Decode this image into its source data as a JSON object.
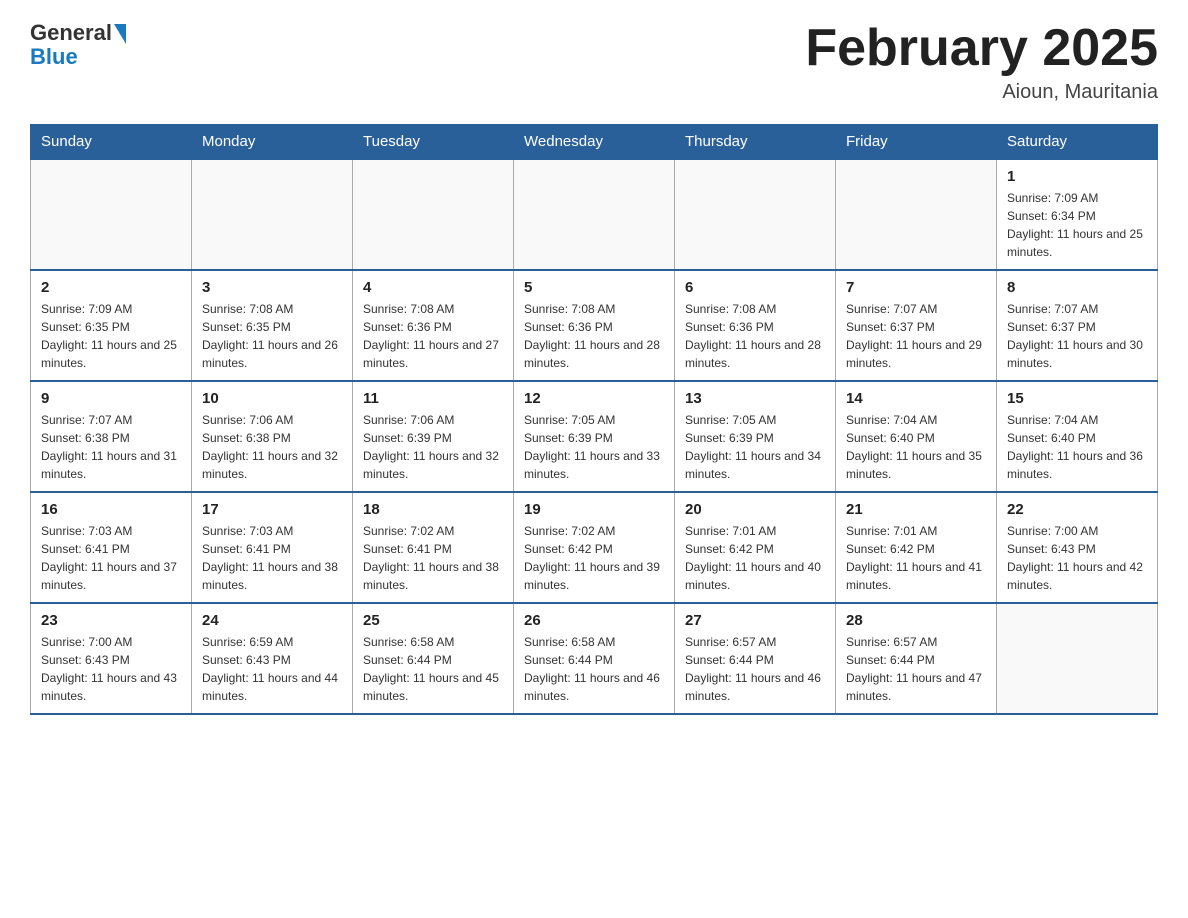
{
  "header": {
    "logo_general": "General",
    "logo_blue": "Blue",
    "month_title": "February 2025",
    "location": "Aioun, Mauritania"
  },
  "days_of_week": [
    "Sunday",
    "Monday",
    "Tuesday",
    "Wednesday",
    "Thursday",
    "Friday",
    "Saturday"
  ],
  "weeks": [
    {
      "days": [
        {
          "number": "",
          "info": ""
        },
        {
          "number": "",
          "info": ""
        },
        {
          "number": "",
          "info": ""
        },
        {
          "number": "",
          "info": ""
        },
        {
          "number": "",
          "info": ""
        },
        {
          "number": "",
          "info": ""
        },
        {
          "number": "1",
          "info": "Sunrise: 7:09 AM\nSunset: 6:34 PM\nDaylight: 11 hours and 25 minutes."
        }
      ]
    },
    {
      "days": [
        {
          "number": "2",
          "info": "Sunrise: 7:09 AM\nSunset: 6:35 PM\nDaylight: 11 hours and 25 minutes."
        },
        {
          "number": "3",
          "info": "Sunrise: 7:08 AM\nSunset: 6:35 PM\nDaylight: 11 hours and 26 minutes."
        },
        {
          "number": "4",
          "info": "Sunrise: 7:08 AM\nSunset: 6:36 PM\nDaylight: 11 hours and 27 minutes."
        },
        {
          "number": "5",
          "info": "Sunrise: 7:08 AM\nSunset: 6:36 PM\nDaylight: 11 hours and 28 minutes."
        },
        {
          "number": "6",
          "info": "Sunrise: 7:08 AM\nSunset: 6:36 PM\nDaylight: 11 hours and 28 minutes."
        },
        {
          "number": "7",
          "info": "Sunrise: 7:07 AM\nSunset: 6:37 PM\nDaylight: 11 hours and 29 minutes."
        },
        {
          "number": "8",
          "info": "Sunrise: 7:07 AM\nSunset: 6:37 PM\nDaylight: 11 hours and 30 minutes."
        }
      ]
    },
    {
      "days": [
        {
          "number": "9",
          "info": "Sunrise: 7:07 AM\nSunset: 6:38 PM\nDaylight: 11 hours and 31 minutes."
        },
        {
          "number": "10",
          "info": "Sunrise: 7:06 AM\nSunset: 6:38 PM\nDaylight: 11 hours and 32 minutes."
        },
        {
          "number": "11",
          "info": "Sunrise: 7:06 AM\nSunset: 6:39 PM\nDaylight: 11 hours and 32 minutes."
        },
        {
          "number": "12",
          "info": "Sunrise: 7:05 AM\nSunset: 6:39 PM\nDaylight: 11 hours and 33 minutes."
        },
        {
          "number": "13",
          "info": "Sunrise: 7:05 AM\nSunset: 6:39 PM\nDaylight: 11 hours and 34 minutes."
        },
        {
          "number": "14",
          "info": "Sunrise: 7:04 AM\nSunset: 6:40 PM\nDaylight: 11 hours and 35 minutes."
        },
        {
          "number": "15",
          "info": "Sunrise: 7:04 AM\nSunset: 6:40 PM\nDaylight: 11 hours and 36 minutes."
        }
      ]
    },
    {
      "days": [
        {
          "number": "16",
          "info": "Sunrise: 7:03 AM\nSunset: 6:41 PM\nDaylight: 11 hours and 37 minutes."
        },
        {
          "number": "17",
          "info": "Sunrise: 7:03 AM\nSunset: 6:41 PM\nDaylight: 11 hours and 38 minutes."
        },
        {
          "number": "18",
          "info": "Sunrise: 7:02 AM\nSunset: 6:41 PM\nDaylight: 11 hours and 38 minutes."
        },
        {
          "number": "19",
          "info": "Sunrise: 7:02 AM\nSunset: 6:42 PM\nDaylight: 11 hours and 39 minutes."
        },
        {
          "number": "20",
          "info": "Sunrise: 7:01 AM\nSunset: 6:42 PM\nDaylight: 11 hours and 40 minutes."
        },
        {
          "number": "21",
          "info": "Sunrise: 7:01 AM\nSunset: 6:42 PM\nDaylight: 11 hours and 41 minutes."
        },
        {
          "number": "22",
          "info": "Sunrise: 7:00 AM\nSunset: 6:43 PM\nDaylight: 11 hours and 42 minutes."
        }
      ]
    },
    {
      "days": [
        {
          "number": "23",
          "info": "Sunrise: 7:00 AM\nSunset: 6:43 PM\nDaylight: 11 hours and 43 minutes."
        },
        {
          "number": "24",
          "info": "Sunrise: 6:59 AM\nSunset: 6:43 PM\nDaylight: 11 hours and 44 minutes."
        },
        {
          "number": "25",
          "info": "Sunrise: 6:58 AM\nSunset: 6:44 PM\nDaylight: 11 hours and 45 minutes."
        },
        {
          "number": "26",
          "info": "Sunrise: 6:58 AM\nSunset: 6:44 PM\nDaylight: 11 hours and 46 minutes."
        },
        {
          "number": "27",
          "info": "Sunrise: 6:57 AM\nSunset: 6:44 PM\nDaylight: 11 hours and 46 minutes."
        },
        {
          "number": "28",
          "info": "Sunrise: 6:57 AM\nSunset: 6:44 PM\nDaylight: 11 hours and 47 minutes."
        },
        {
          "number": "",
          "info": ""
        }
      ]
    }
  ]
}
